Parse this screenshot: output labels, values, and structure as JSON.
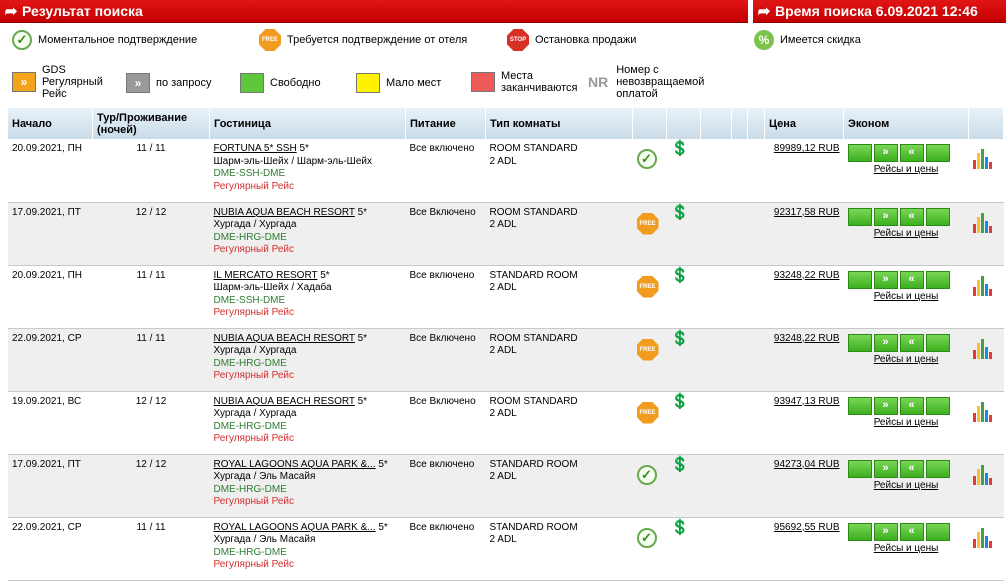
{
  "header": {
    "left_title": "Результат поиска",
    "right_title": "Время поиска 6.09.2021 12:46"
  },
  "legend": {
    "row1": [
      {
        "icon": "check-circle-icon",
        "label": "Моментальное подтверждение"
      },
      {
        "icon": "free-octagon-icon",
        "label": "Требуется подтверждение от отеля",
        "badge": "FREE"
      },
      {
        "icon": "stop-octagon-icon",
        "label": "Остановка продажи",
        "badge": "STOP"
      },
      {
        "icon": "percent-circle-icon",
        "label": "Имеется скидка",
        "badge": "%"
      }
    ],
    "row2": [
      {
        "icon": "gds-icon",
        "label": "GDS Регулярный Рейс"
      },
      {
        "icon": "request-icon",
        "label": "по запросу"
      },
      {
        "icon": "available-square-icon",
        "label": "Свободно"
      },
      {
        "icon": "few-seats-square-icon",
        "label": "Мало мест"
      },
      {
        "icon": "running-out-square-icon",
        "label": "Места заканчиваются"
      },
      {
        "icon": "nr-icon",
        "badge": "NR",
        "label": "Номер с невозвращаемой оплатой"
      }
    ]
  },
  "table": {
    "headers": {
      "start": "Начало",
      "tour": "Тур/Проживание (ночей)",
      "hotel": "Гостиница",
      "meal": "Питание",
      "room": "Тип комнаты",
      "price": "Цена",
      "econom": "Эконом"
    },
    "flights_label": "Рейсы и цены",
    "rows": [
      {
        "date": "20.09.2021, ПН",
        "nights": "11 / 11",
        "hotel": "FORTUNA 5* SSH",
        "stars": "5*",
        "location": "Шарм-эль-Шейх / Шарм-эль-Шейх",
        "route": "DME-SSH-DME",
        "flight": "Регулярный Рейс",
        "meal": "Все включено",
        "room": "ROOM STANDARD",
        "adl": "2 ADL",
        "status": "instant",
        "price": "89989,12 RUB"
      },
      {
        "date": "17.09.2021, ПТ",
        "nights": "12 / 12",
        "hotel": "NUBIA AQUA BEACH RESORT",
        "stars": "5*",
        "location": "Хургада / Хургада",
        "route": "DME-HRG-DME",
        "flight": "Регулярный Рейс",
        "meal": "Все Включено",
        "room": "ROOM STANDARD",
        "adl": "2 ADL",
        "status": "free",
        "price": "92317,58 RUB"
      },
      {
        "date": "20.09.2021, ПН",
        "nights": "11 / 11",
        "hotel": "IL MERCATO RESORT",
        "stars": "5*",
        "location": "Шарм-эль-Шейх / Хадаба",
        "route": "DME-SSH-DME",
        "flight": "Регулярный Рейс",
        "meal": "Все включено",
        "room": "STANDARD ROOM",
        "adl": "2 ADL",
        "status": "free",
        "price": "93248,22 RUB"
      },
      {
        "date": "22.09.2021, СР",
        "nights": "11 / 11",
        "hotel": "NUBIA AQUA BEACH RESORT",
        "stars": "5*",
        "location": "Хургада / Хургада",
        "route": "DME-HRG-DME",
        "flight": "Регулярный Рейс",
        "meal": "Все Включено",
        "room": "ROOM STANDARD",
        "adl": "2 ADL",
        "status": "free",
        "price": "93248,22 RUB"
      },
      {
        "date": "19.09.2021, ВС",
        "nights": "12 / 12",
        "hotel": "NUBIA AQUA BEACH RESORT",
        "stars": "5*",
        "location": "Хургада / Хургада",
        "route": "DME-HRG-DME",
        "flight": "Регулярный Рейс",
        "meal": "Все Включено",
        "room": "ROOM STANDARD",
        "adl": "2 ADL",
        "status": "free",
        "price": "93947,13 RUB"
      },
      {
        "date": "17.09.2021, ПТ",
        "nights": "12 / 12",
        "hotel": "ROYAL LAGOONS AQUA PARK &...",
        "stars": "5*",
        "location": "Хургада / Эль Масайя",
        "route": "DME-HRG-DME",
        "flight": "Регулярный Рейс",
        "meal": "Все включено",
        "room": "STANDARD ROOM",
        "adl": "2 ADL",
        "status": "instant",
        "price": "94273,04 RUB"
      },
      {
        "date": "22.09.2021, СР",
        "nights": "11 / 11",
        "hotel": "ROYAL LAGOONS AQUA PARK &...",
        "stars": "5*",
        "location": "Хургада / Эль Масайя",
        "route": "DME-HRG-DME",
        "flight": "Регулярный Рейс",
        "meal": "Все включено",
        "room": "STANDARD ROOM",
        "adl": "2 ADL",
        "status": "instant",
        "price": "95692,55 RUB"
      }
    ]
  }
}
